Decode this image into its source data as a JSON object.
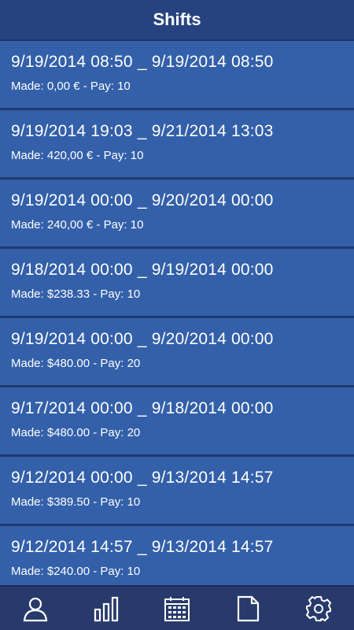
{
  "header": {
    "title": "Shifts"
  },
  "shifts": [
    {
      "range": "9/19/2014 08:50 _ 9/19/2014 08:50",
      "meta": "Made: 0,00 € - Pay: 10"
    },
    {
      "range": "9/19/2014 19:03 _ 9/21/2014 13:03",
      "meta": "Made: 420,00 € - Pay: 10"
    },
    {
      "range": "9/19/2014 00:00 _ 9/20/2014 00:00",
      "meta": "Made: 240,00 € - Pay: 10"
    },
    {
      "range": "9/18/2014 00:00 _ 9/19/2014 00:00",
      "meta": "Made: $238.33 - Pay: 10"
    },
    {
      "range": "9/19/2014 00:00 _ 9/20/2014 00:00",
      "meta": "Made: $480.00 - Pay: 20"
    },
    {
      "range": "9/17/2014 00:00 _ 9/18/2014 00:00",
      "meta": "Made: $480.00 - Pay: 20"
    },
    {
      "range": "9/12/2014 00:00 _ 9/13/2014 14:57",
      "meta": "Made: $389.50 - Pay: 10"
    },
    {
      "range": "9/12/2014 14:57 _ 9/13/2014 14:57",
      "meta": "Made: $240.00 - Pay: 10"
    }
  ],
  "tabbar": {
    "items": [
      {
        "icon": "profile-icon"
      },
      {
        "icon": "bar-chart-icon"
      },
      {
        "icon": "calendar-icon"
      },
      {
        "icon": "document-icon"
      },
      {
        "icon": "settings-gear-icon"
      }
    ]
  },
  "colors": {
    "header": "#26437f",
    "item": "#3360a9",
    "separator": "#1f3a70",
    "tabbar": "#283a6b"
  }
}
